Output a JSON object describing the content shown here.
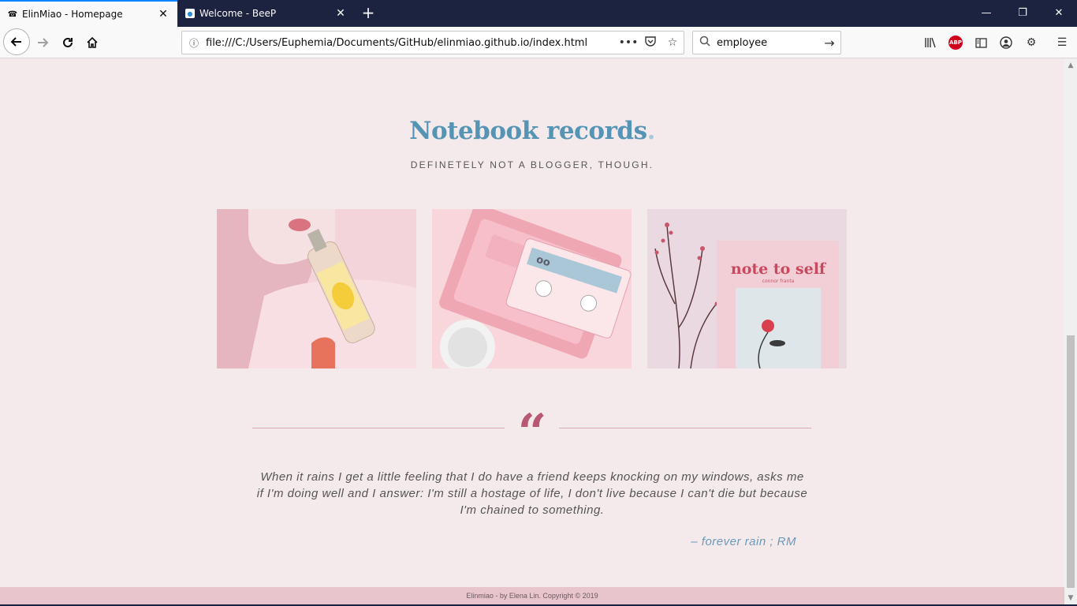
{
  "browser": {
    "tabs": [
      {
        "title": "ElinMiao - Homepage",
        "favicon": "☎"
      },
      {
        "title": "Welcome - BeeP",
        "favicon": "●"
      }
    ],
    "url": "file:///C:/Users/Euphemia/Documents/GitHub/elinmiao.github.io/index.html",
    "search": {
      "value": "employee"
    },
    "abp_label": "ABP"
  },
  "page": {
    "title": "Notebook records",
    "title_dot": ".",
    "subtitle": "DEFINETELY NOT A BLOGGER, THOUGH.",
    "photos": [
      {
        "subject": "girl drinking a bottled drink"
      },
      {
        "subject": "pink cassette tape player"
      },
      {
        "subject": "note to self book with flowers",
        "caption": "note to self",
        "subcaption": "connor franta"
      }
    ],
    "quote": {
      "mark": "“",
      "text": "When it rains I get a little feeling that I do have a friend keeps knocking on my windows, asks me if I'm doing well and I answer: I'm still a hostage of life, I don't live because I can't die but because I'm chained to something.",
      "author": "–   forever rain ; RM"
    },
    "footer": "Elinmiao - by Elena Lin. Copyright © 2019"
  },
  "colors": {
    "title": "#5694b5",
    "quote_mark": "#b85873",
    "footer_bg": "#e8c4cd",
    "page_bg": "#f4eaec"
  }
}
